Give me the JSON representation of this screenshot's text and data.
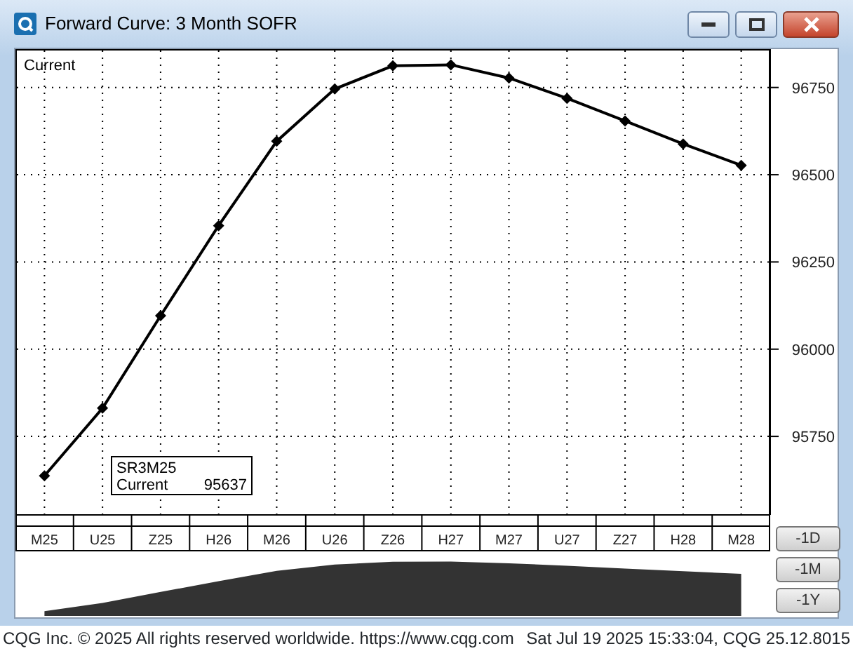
{
  "window": {
    "title": "Forward Curve: 3 Month SOFR"
  },
  "chart": {
    "tooltip": {
      "symbol": "SR3M25",
      "series": "Current",
      "value": "95637"
    },
    "chart_data": {
      "type": "line",
      "grid": true,
      "categories": [
        "M25",
        "U25",
        "Z25",
        "H26",
        "M26",
        "U26",
        "Z26",
        "H27",
        "M27",
        "U27",
        "Z27",
        "H28",
        "M28"
      ],
      "series": [
        {
          "name": "Current",
          "color": "#000000",
          "marker": "diamond",
          "values": [
            95637,
            95831,
            96096,
            96354,
            96596,
            96746,
            96812,
            96815,
            96777,
            96719,
            96654,
            96588,
            96527
          ]
        }
      ],
      "ylim": [
        95525,
        96860
      ],
      "yticks": [
        95750,
        96000,
        96250,
        96500,
        96750
      ]
    }
  },
  "range_buttons": [
    "-1D",
    "-1M",
    "-1Y"
  ],
  "status_bar": {
    "left": "CQG Inc. © 2025 All rights reserved worldwide. https://www.cqg.com",
    "right": "Sat Jul 19 2025 15:33:04, CQG 25.12.8015"
  }
}
